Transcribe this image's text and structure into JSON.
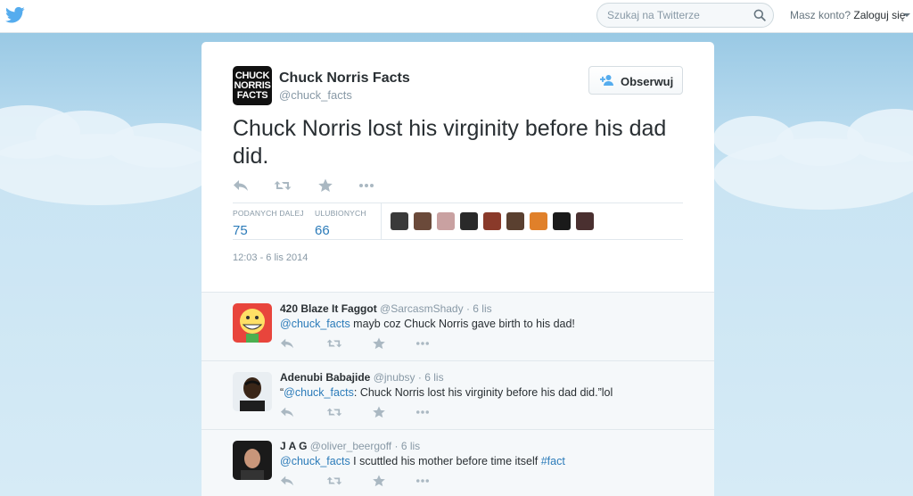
{
  "topbar": {
    "search_placeholder": "Szukaj na Twitterze",
    "login_prompt": "Masz konto?",
    "login_link": "Zaloguj się"
  },
  "tweet": {
    "avatar_text": [
      "CHUCK",
      "NORRIS",
      "FACTS"
    ],
    "author_name": "Chuck Norris Facts",
    "author_handle": "@chuck_facts",
    "follow_label": "Obserwuj",
    "text": "Chuck Norris lost his virginity before his dad did.",
    "retweets_label": "PODANYCH DALEJ",
    "retweets_count": "75",
    "favorites_label": "ULUBIONYCH",
    "favorites_count": "66",
    "timestamp": "12:03 - 6 lis 2014"
  },
  "favoriters": [
    "#3a3a3a",
    "#6b4a3a",
    "#c9a1a1",
    "#2a2a2a",
    "#8a3a2a",
    "#5a4030",
    "#e0802a",
    "#1a1a1a",
    "#4a3030"
  ],
  "replies": [
    {
      "name": "420 Blaze It Faggot",
      "handle": "@SarcasmShady",
      "time": "6 lis",
      "link": "@chuck_facts",
      "text_before": "",
      "text_after": " mayb coz Chuck Norris gave birth to his dad!",
      "hashtag": "",
      "avatar": "smiley"
    },
    {
      "name": "Adenubi Babajide",
      "handle": "@jnubsy",
      "time": "6 lis",
      "text_before": "“",
      "link": "@chuck_facts",
      "text_after": ": Chuck Norris lost his virginity before his dad did.”lol",
      "hashtag": "",
      "avatar": "person"
    },
    {
      "name": "J A G",
      "handle": "@oliver_beergoff",
      "time": "6 lis",
      "text_before": "",
      "link": "@chuck_facts",
      "text_after": " I scuttled his mother before time itself ",
      "hashtag": "#fact",
      "avatar": "person-dark"
    }
  ],
  "icons": {
    "reply": "reply-icon",
    "retweet": "retweet-icon",
    "favorite": "star-icon",
    "more": "more-icon"
  },
  "colors": {
    "link": "#2b7bb9",
    "muted": "#8899a6",
    "twitter_blue": "#55acee"
  }
}
